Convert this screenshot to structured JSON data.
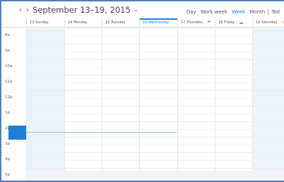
{
  "header": {
    "prev_arrow": "‹",
    "next_arrow": "›",
    "date_range": "September 13–19, 2015",
    "date_chevron": "⌄"
  },
  "views": {
    "day": "Day",
    "work_week": "Work week",
    "week": "Week",
    "month": "Month",
    "today": "Tod",
    "active": "Week"
  },
  "days": [
    {
      "label": "13 Sunday",
      "weather_icon": ""
    },
    {
      "label": "14 Monday",
      "weather_icon": ""
    },
    {
      "label": "15 Tuesday",
      "weather_icon": ""
    },
    {
      "label": "16 Wednesday",
      "weather_icon": ""
    },
    {
      "label": "17 Thursday",
      "weather_icon": "☂"
    },
    {
      "label": "18 Friday",
      "weather_icon": "☁"
    },
    {
      "label": "19 Saturday",
      "weather_icon": "☀"
    }
  ],
  "today_index": 3,
  "times": [
    "8a",
    "9a",
    "10a",
    "11a",
    "12p",
    "1p",
    "2p",
    "3p",
    "4p",
    "5p"
  ],
  "colors": {
    "accent": "#1f7fd6",
    "weekend_bg": "#eaf3fc",
    "now_block": "#1e7fd8"
  }
}
